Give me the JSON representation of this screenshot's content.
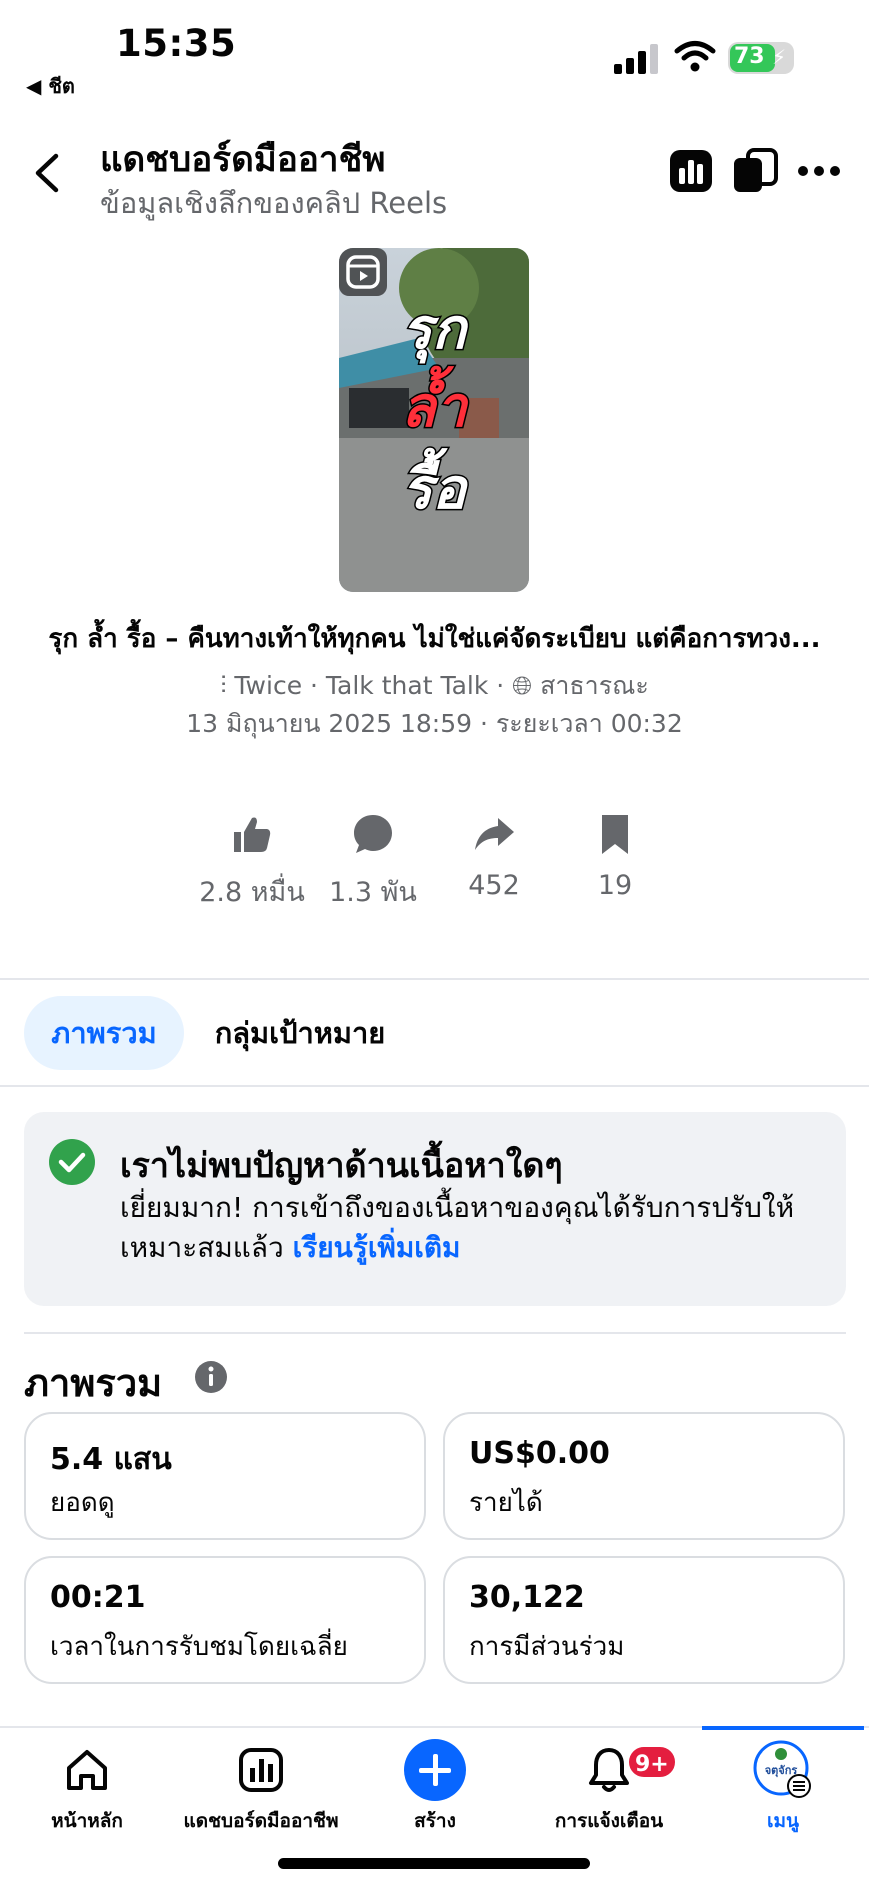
{
  "status_bar": {
    "time": "15:35",
    "back_app": "◀ ชีต",
    "battery": "73",
    "battery_level": 0.73
  },
  "header": {
    "title": "แดชบอร์ดมืออาชีพ",
    "subtitle": "ข้อมูลเชิงลึกของคลิป Reels"
  },
  "thumbnail": {
    "line1": "รุก",
    "line2": "ล้ำ",
    "line3": "รื้อ"
  },
  "reel": {
    "caption": "รุก ล้ำ รื้อ – คืนทางเท้าให้ทุกคน ไม่ใช่แค่จัดระเบียบ แต่คือการทวง...",
    "audio": "Twice · Talk that Talk · ",
    "privacy": "สาธารณะ",
    "date_line": "13 มิถุนายน  2025 18:59 · ระยะเวลา 00:32"
  },
  "engagement": [
    {
      "icon": "like-icon",
      "value": "2.8 หมื่น"
    },
    {
      "icon": "comment-icon",
      "value": "1.3 พัน"
    },
    {
      "icon": "share-icon",
      "value": "452"
    },
    {
      "icon": "bookmark-icon",
      "value": "19"
    }
  ],
  "tabs": [
    {
      "label": "ภาพรวม",
      "active": true
    },
    {
      "label": "กลุ่มเป้าหมาย",
      "active": false
    }
  ],
  "info_card": {
    "title": "เราไม่พบปัญหาด้านเนื้อหาใดๆ",
    "body": "เยี่ยมมาก! การเข้าถึงของเนื้อหาของคุณได้รับการปรับให้เหมาะสมแล้ว ",
    "link": "เรียนรู้เพิ่มเติม"
  },
  "overview": {
    "title": "ภาพรวม",
    "metrics": [
      {
        "value": "5.4 แสน",
        "label": "ยอดดู"
      },
      {
        "value": "US$0.00",
        "label": "รายได้"
      },
      {
        "value": "00:21",
        "label": "เวลาในการรับชมโดยเฉลี่ย"
      },
      {
        "value": "30,122",
        "label": "การมีส่วนร่วม"
      }
    ]
  },
  "bottom_nav": [
    {
      "label": "หน้าหลัก"
    },
    {
      "label": "แดชบอร์ดมืออาชีพ"
    },
    {
      "label": "สร้าง"
    },
    {
      "label": "การแจ้งเตือน",
      "badge": "9+"
    },
    {
      "label": "เมนู",
      "active": true,
      "avatar_text": "จตุจักร"
    }
  ],
  "colors": {
    "accent": "#0866ff",
    "success": "#31a24c",
    "badge": "#e41e3f",
    "muted": "#65676b"
  }
}
